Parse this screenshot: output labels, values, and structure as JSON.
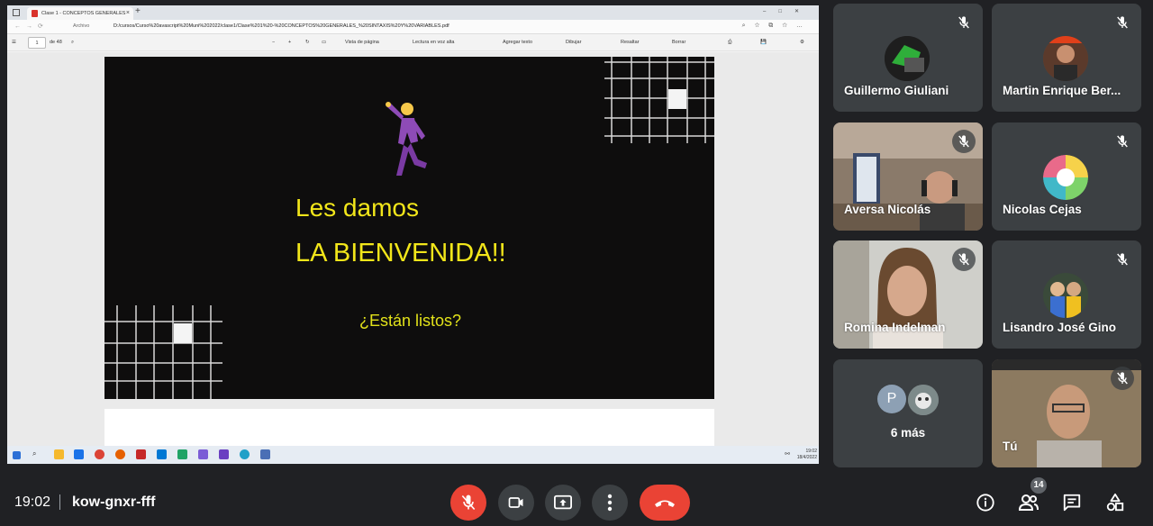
{
  "browser": {
    "tab_title": "Clase 1 - CONCEPTOS GENERALES",
    "new_tab": "+",
    "address_info": "Archivo",
    "url": "D:/cursos/Curso%20avascript%20Muni%202022/clase1/Clase%201%20-%20CONCEPTOS%20GENERALES_%20SINTAXIS%20Y%20VARIABLES.pdf"
  },
  "pdf_toolbar": {
    "page_number": "1",
    "page_total": "de 48",
    "page_view": "Vista de página",
    "read_aloud": "Lectura en voz alta",
    "add_text": "Agregar texto",
    "draw": "Dibujar",
    "highlight": "Resaltar",
    "erase": "Borrar"
  },
  "slide": {
    "line1": "Les damos",
    "line2": "LA BIENVENIDA!!",
    "question": "¿Están listos?"
  },
  "taskbar": {
    "time": "19:02",
    "date": "18/4/2022"
  },
  "participants": [
    {
      "name": "Guillermo Giuliani"
    },
    {
      "name": "Martin Enrique Ber..."
    },
    {
      "name": "Aversa Nicolás"
    },
    {
      "name": "Nicolas Cejas"
    },
    {
      "name": "Romina Indelman"
    },
    {
      "name": "Lisandro José Gino"
    },
    {
      "name": "Tú"
    }
  ],
  "more_participants": {
    "initial": "P",
    "label": "6 más"
  },
  "meeting": {
    "time": "19:02",
    "code": "kow-gnxr-fff",
    "participant_count": "14"
  },
  "colors": {
    "background": "#202124",
    "tile": "#3c4043",
    "red": "#ea4335",
    "slide_text": "#f2e61a"
  }
}
